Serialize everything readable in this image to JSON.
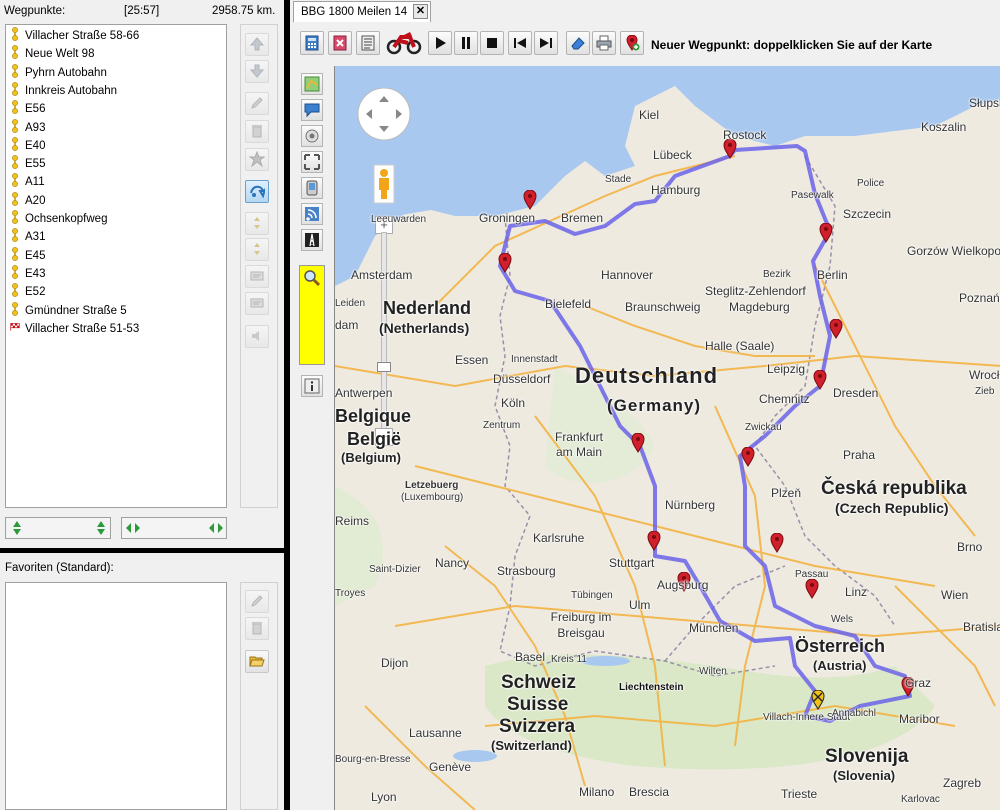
{
  "waypoints_panel": {
    "label": "Wegpunkte:",
    "duration": "[25:57]",
    "distance": "2958.75 km.",
    "items": [
      {
        "name": "Villacher Straße 58-66",
        "icon": "start-pin"
      },
      {
        "name": "Neue Welt 98",
        "icon": "pin"
      },
      {
        "name": "Pyhrn Autobahn",
        "icon": "pin"
      },
      {
        "name": "Innkreis Autobahn",
        "icon": "pin"
      },
      {
        "name": "E56",
        "icon": "pin"
      },
      {
        "name": "A93",
        "icon": "pin"
      },
      {
        "name": "E40",
        "icon": "pin"
      },
      {
        "name": "E55",
        "icon": "pin"
      },
      {
        "name": "A11",
        "icon": "pin"
      },
      {
        "name": "A20",
        "icon": "pin"
      },
      {
        "name": "Ochsenkopfweg",
        "icon": "pin"
      },
      {
        "name": "A31",
        "icon": "pin"
      },
      {
        "name": "E45",
        "icon": "pin"
      },
      {
        "name": "E43",
        "icon": "pin"
      },
      {
        "name": "E52",
        "icon": "pin"
      },
      {
        "name": "Gmündner Straße 5",
        "icon": "pin"
      },
      {
        "name": "Villacher Straße 51-53",
        "icon": "finish-flag"
      }
    ]
  },
  "favorites_panel": {
    "label": "Favoriten (Standard):"
  },
  "tab": {
    "title": "BBG 1800 Meilen 14",
    "close": "✕"
  },
  "toolbar": {
    "hint": "Neuer Wegpunkt: doppelklicken Sie auf der Karte"
  },
  "colors": {
    "route": "#6a63e8",
    "marker": "#d0202c",
    "highlight": "#ffff00"
  },
  "map": {
    "countries": [
      {
        "name": "Deutschland",
        "sub": "(Germany)"
      },
      {
        "name": "Nederland",
        "sub": "(Netherlands)"
      },
      {
        "name": "Belgique",
        "sub2": "België",
        "sub": "(Belgium)"
      },
      {
        "name": "Česká republika",
        "sub": "(Czech Republic)"
      },
      {
        "name": "Österreich",
        "sub": "(Austria)"
      },
      {
        "name": "Schweiz",
        "sub2": "Suisse",
        "sub3": "Svizzera",
        "sub": "(Switzerland)"
      },
      {
        "name": "Slovenija",
        "sub": "(Slovenia)"
      }
    ],
    "cities": [
      "Kiel",
      "Rostock",
      "Koszalin",
      "Lübeck",
      "Hamburg",
      "Stade",
      "Police",
      "Pasewalk",
      "Szczecin",
      "Groningen",
      "Bremen",
      "Leeuwarden",
      "Amsterdam",
      "Hannover",
      "Bezirk",
      "Berlin",
      "Steglitz-Zehlendorf",
      "Gorzów Wielkopolski",
      "Bielefeld",
      "Braunschweig",
      "Magdeburg",
      "Poznań",
      "Leiden",
      "dam",
      "Halle (Saale)",
      "Leipzig",
      "Essen",
      "Innenstadt",
      "Düsseldorf",
      "Wrocław",
      "Antwerpen",
      "Chemnitz",
      "Dresden",
      "Köln",
      "Zentrum",
      "Zwickau",
      "Frankfurt am Main",
      "Praha",
      "Letzebuerg",
      "(Luxembourg)",
      "Nürnberg",
      "Plzeň",
      "Reims",
      "Karlsruhe",
      "Stuttgart",
      "Brno",
      "Saint-Dizier",
      "Nancy",
      "Strasbourg",
      "Passau",
      "Tübingen",
      "Augsburg",
      "Linz",
      "Wien",
      "Troyes",
      "Ulm",
      "Freiburg im Breisgau",
      "Wels",
      "München",
      "Bratislava",
      "Dijon",
      "Basel",
      "Kreis 11",
      "Wilten",
      "Graz",
      "Liechtenstein",
      "Lausanne",
      "Villach-Innere Stadt",
      "Annabichl",
      "Maribor",
      "Genève",
      "Zagreb",
      "Lyon",
      "Milano",
      "Brescia",
      "Trieste",
      "Karlovac",
      "Bourg-en-Bresse",
      "Słupsk",
      "Zieb"
    ]
  }
}
